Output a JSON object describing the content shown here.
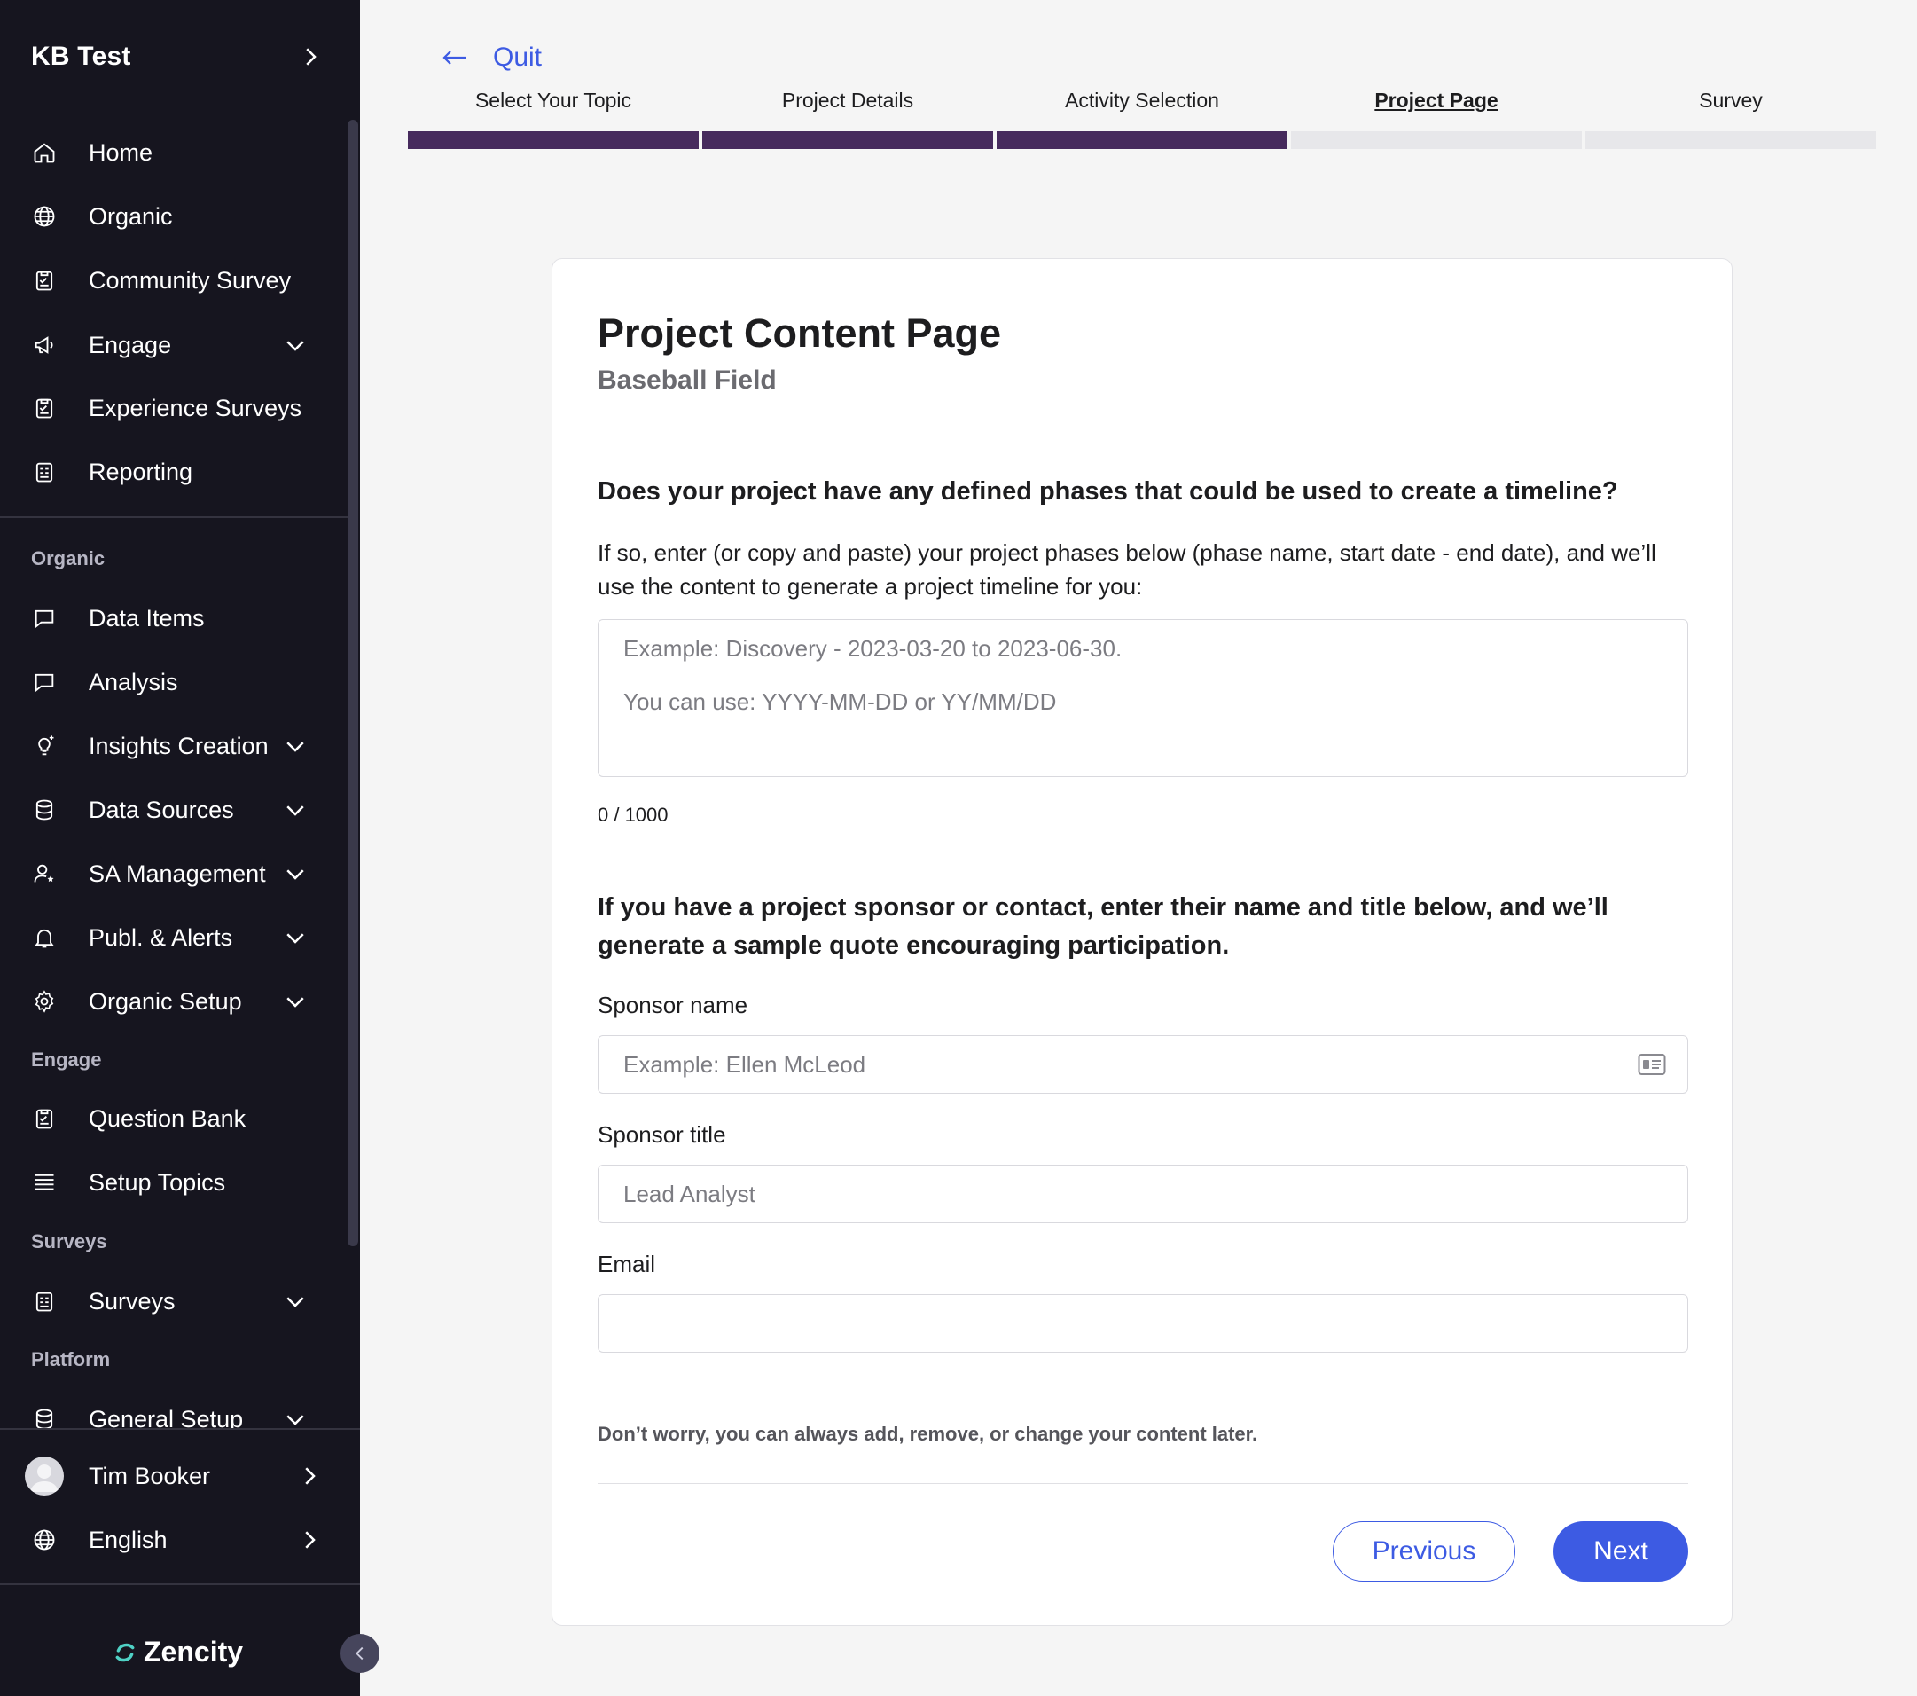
{
  "sidebar": {
    "org_name": "KB Test",
    "top_items": [
      {
        "label": "Home",
        "icon": "home-icon"
      },
      {
        "label": "Organic",
        "icon": "globe-icon"
      },
      {
        "label": "Community Survey",
        "icon": "clipboard-icon"
      },
      {
        "label": "Engage",
        "icon": "megaphone-icon",
        "dropdown": true
      },
      {
        "label": "Experience Surveys",
        "icon": "clipboard-icon"
      },
      {
        "label": "Reporting",
        "icon": "report-icon"
      }
    ],
    "sections": {
      "organic": "Organic",
      "engage": "Engage",
      "surveys": "Surveys",
      "platform": "Platform"
    },
    "organic_items": [
      {
        "label": "Data Items",
        "icon": "chat-icon"
      },
      {
        "label": "Analysis",
        "icon": "chat-icon"
      },
      {
        "label": "Insights Creation",
        "icon": "lightbulb-icon",
        "dropdown": true
      },
      {
        "label": "Data Sources",
        "icon": "database-icon",
        "dropdown": true
      },
      {
        "label": "SA Management",
        "icon": "user-star-icon",
        "dropdown": true
      },
      {
        "label": "Publ. & Alerts",
        "icon": "bell-icon",
        "dropdown": true
      },
      {
        "label": "Organic Setup",
        "icon": "gear-icon",
        "dropdown": true
      }
    ],
    "engage_items": [
      {
        "label": "Question Bank",
        "icon": "clipboard-icon"
      },
      {
        "label": "Setup Topics",
        "icon": "list-icon"
      }
    ],
    "surveys_items": [
      {
        "label": "Surveys",
        "icon": "report-icon",
        "dropdown": true
      }
    ],
    "platform_items": [
      {
        "label": "General Setup",
        "icon": "database-icon",
        "dropdown": true
      }
    ],
    "footer": {
      "user_name": "Tim Booker",
      "language": "English",
      "brand": "Zencity"
    }
  },
  "progress": {
    "quit_label": "Quit",
    "steps": [
      {
        "label": "Select Your Topic",
        "status": "done"
      },
      {
        "label": "Project Details",
        "status": "done"
      },
      {
        "label": "Activity Selection",
        "status": "done"
      },
      {
        "label": "Project Page",
        "status": "current"
      },
      {
        "label": "Survey",
        "status": "todo"
      }
    ],
    "completed_color": "#462a5d"
  },
  "card": {
    "title": "Project Content Page",
    "subtitle": "Baseball Field",
    "question_timeline": "Does your project have any defined phases that could be used to create a timeline?",
    "timeline_description": "If so, enter (or copy and paste) your project phases below (phase name, start date - end date), and we’ll use the content to generate a project timeline for you:",
    "timeline_placeholder_1": "Example: Discovery - 2023-03-20 to 2023-06-30.",
    "timeline_placeholder_2": "You can use: YYYY-MM-DD or YY/MM/DD",
    "char_counter": "0 / 1000",
    "question_sponsor": "If you have a project sponsor or contact, enter their name and title below, and we’ll generate a sample quote encouraging participation.",
    "sponsor_name_label": "Sponsor name",
    "sponsor_name_placeholder": "Example: Ellen McLeod",
    "sponsor_title_label": "Sponsor title",
    "sponsor_title_placeholder": "Lead Analyst",
    "email_label": "Email",
    "email_value": "",
    "note": "Don’t worry, you can always add, remove, or change your content later.",
    "previous_label": "Previous",
    "next_label": "Next",
    "accent_color": "#3d5be3"
  }
}
